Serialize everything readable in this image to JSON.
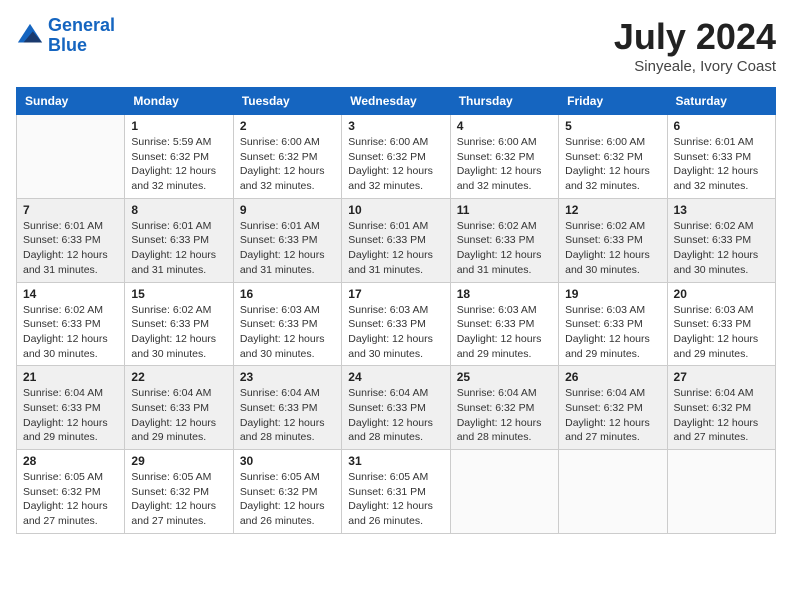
{
  "header": {
    "logo_line1": "General",
    "logo_line2": "Blue",
    "month_year": "July 2024",
    "location": "Sinyeale, Ivory Coast"
  },
  "days_of_week": [
    "Sunday",
    "Monday",
    "Tuesday",
    "Wednesday",
    "Thursday",
    "Friday",
    "Saturday"
  ],
  "weeks": [
    [
      {
        "day": "",
        "sunrise": "",
        "sunset": "",
        "daylight": ""
      },
      {
        "day": "1",
        "sunrise": "Sunrise: 5:59 AM",
        "sunset": "Sunset: 6:32 PM",
        "daylight": "Daylight: 12 hours and 32 minutes."
      },
      {
        "day": "2",
        "sunrise": "Sunrise: 6:00 AM",
        "sunset": "Sunset: 6:32 PM",
        "daylight": "Daylight: 12 hours and 32 minutes."
      },
      {
        "day": "3",
        "sunrise": "Sunrise: 6:00 AM",
        "sunset": "Sunset: 6:32 PM",
        "daylight": "Daylight: 12 hours and 32 minutes."
      },
      {
        "day": "4",
        "sunrise": "Sunrise: 6:00 AM",
        "sunset": "Sunset: 6:32 PM",
        "daylight": "Daylight: 12 hours and 32 minutes."
      },
      {
        "day": "5",
        "sunrise": "Sunrise: 6:00 AM",
        "sunset": "Sunset: 6:32 PM",
        "daylight": "Daylight: 12 hours and 32 minutes."
      },
      {
        "day": "6",
        "sunrise": "Sunrise: 6:01 AM",
        "sunset": "Sunset: 6:33 PM",
        "daylight": "Daylight: 12 hours and 32 minutes."
      }
    ],
    [
      {
        "day": "7",
        "sunrise": "Sunrise: 6:01 AM",
        "sunset": "Sunset: 6:33 PM",
        "daylight": "Daylight: 12 hours and 31 minutes."
      },
      {
        "day": "8",
        "sunrise": "Sunrise: 6:01 AM",
        "sunset": "Sunset: 6:33 PM",
        "daylight": "Daylight: 12 hours and 31 minutes."
      },
      {
        "day": "9",
        "sunrise": "Sunrise: 6:01 AM",
        "sunset": "Sunset: 6:33 PM",
        "daylight": "Daylight: 12 hours and 31 minutes."
      },
      {
        "day": "10",
        "sunrise": "Sunrise: 6:01 AM",
        "sunset": "Sunset: 6:33 PM",
        "daylight": "Daylight: 12 hours and 31 minutes."
      },
      {
        "day": "11",
        "sunrise": "Sunrise: 6:02 AM",
        "sunset": "Sunset: 6:33 PM",
        "daylight": "Daylight: 12 hours and 31 minutes."
      },
      {
        "day": "12",
        "sunrise": "Sunrise: 6:02 AM",
        "sunset": "Sunset: 6:33 PM",
        "daylight": "Daylight: 12 hours and 30 minutes."
      },
      {
        "day": "13",
        "sunrise": "Sunrise: 6:02 AM",
        "sunset": "Sunset: 6:33 PM",
        "daylight": "Daylight: 12 hours and 30 minutes."
      }
    ],
    [
      {
        "day": "14",
        "sunrise": "Sunrise: 6:02 AM",
        "sunset": "Sunset: 6:33 PM",
        "daylight": "Daylight: 12 hours and 30 minutes."
      },
      {
        "day": "15",
        "sunrise": "Sunrise: 6:02 AM",
        "sunset": "Sunset: 6:33 PM",
        "daylight": "Daylight: 12 hours and 30 minutes."
      },
      {
        "day": "16",
        "sunrise": "Sunrise: 6:03 AM",
        "sunset": "Sunset: 6:33 PM",
        "daylight": "Daylight: 12 hours and 30 minutes."
      },
      {
        "day": "17",
        "sunrise": "Sunrise: 6:03 AM",
        "sunset": "Sunset: 6:33 PM",
        "daylight": "Daylight: 12 hours and 30 minutes."
      },
      {
        "day": "18",
        "sunrise": "Sunrise: 6:03 AM",
        "sunset": "Sunset: 6:33 PM",
        "daylight": "Daylight: 12 hours and 29 minutes."
      },
      {
        "day": "19",
        "sunrise": "Sunrise: 6:03 AM",
        "sunset": "Sunset: 6:33 PM",
        "daylight": "Daylight: 12 hours and 29 minutes."
      },
      {
        "day": "20",
        "sunrise": "Sunrise: 6:03 AM",
        "sunset": "Sunset: 6:33 PM",
        "daylight": "Daylight: 12 hours and 29 minutes."
      }
    ],
    [
      {
        "day": "21",
        "sunrise": "Sunrise: 6:04 AM",
        "sunset": "Sunset: 6:33 PM",
        "daylight": "Daylight: 12 hours and 29 minutes."
      },
      {
        "day": "22",
        "sunrise": "Sunrise: 6:04 AM",
        "sunset": "Sunset: 6:33 PM",
        "daylight": "Daylight: 12 hours and 29 minutes."
      },
      {
        "day": "23",
        "sunrise": "Sunrise: 6:04 AM",
        "sunset": "Sunset: 6:33 PM",
        "daylight": "Daylight: 12 hours and 28 minutes."
      },
      {
        "day": "24",
        "sunrise": "Sunrise: 6:04 AM",
        "sunset": "Sunset: 6:33 PM",
        "daylight": "Daylight: 12 hours and 28 minutes."
      },
      {
        "day": "25",
        "sunrise": "Sunrise: 6:04 AM",
        "sunset": "Sunset: 6:32 PM",
        "daylight": "Daylight: 12 hours and 28 minutes."
      },
      {
        "day": "26",
        "sunrise": "Sunrise: 6:04 AM",
        "sunset": "Sunset: 6:32 PM",
        "daylight": "Daylight: 12 hours and 27 minutes."
      },
      {
        "day": "27",
        "sunrise": "Sunrise: 6:04 AM",
        "sunset": "Sunset: 6:32 PM",
        "daylight": "Daylight: 12 hours and 27 minutes."
      }
    ],
    [
      {
        "day": "28",
        "sunrise": "Sunrise: 6:05 AM",
        "sunset": "Sunset: 6:32 PM",
        "daylight": "Daylight: 12 hours and 27 minutes."
      },
      {
        "day": "29",
        "sunrise": "Sunrise: 6:05 AM",
        "sunset": "Sunset: 6:32 PM",
        "daylight": "Daylight: 12 hours and 27 minutes."
      },
      {
        "day": "30",
        "sunrise": "Sunrise: 6:05 AM",
        "sunset": "Sunset: 6:32 PM",
        "daylight": "Daylight: 12 hours and 26 minutes."
      },
      {
        "day": "31",
        "sunrise": "Sunrise: 6:05 AM",
        "sunset": "Sunset: 6:31 PM",
        "daylight": "Daylight: 12 hours and 26 minutes."
      },
      {
        "day": "",
        "sunrise": "",
        "sunset": "",
        "daylight": ""
      },
      {
        "day": "",
        "sunrise": "",
        "sunset": "",
        "daylight": ""
      },
      {
        "day": "",
        "sunrise": "",
        "sunset": "",
        "daylight": ""
      }
    ]
  ]
}
